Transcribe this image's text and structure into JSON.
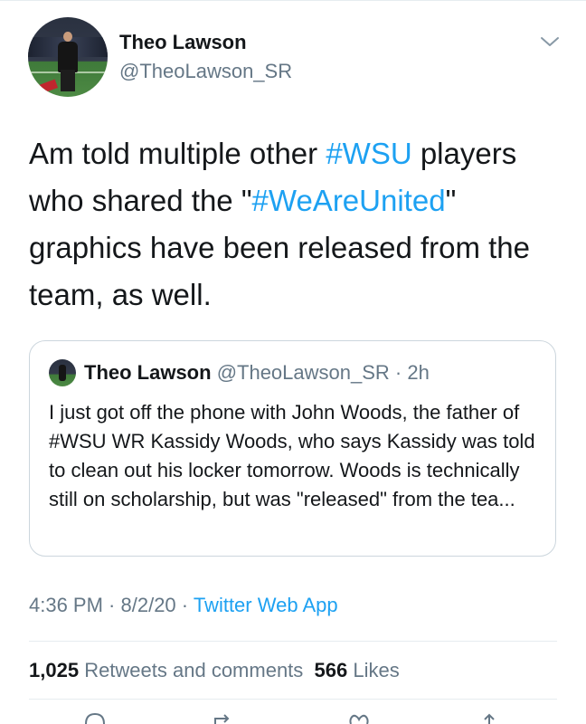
{
  "author": {
    "name": "Theo Lawson",
    "handle": "@TheoLawson_SR"
  },
  "tweet": {
    "text_parts": {
      "t1": "Am told multiple other ",
      "h1": "#WSU",
      "t2": " players who shared the \"",
      "h2": "#WeAreUnited",
      "t3": "\" graphics have been released from the team, as well."
    }
  },
  "quoted_tweet": {
    "name": "Theo Lawson",
    "handle": "@TheoLawson_SR",
    "time": " · 2h",
    "text": "I just got off the phone with John Woods, the father of #WSU WR Kassidy Woods, who says Kassidy was told to clean out his locker tomorrow. Woods is technically still on scholarship, but was \"released\" from the tea..."
  },
  "meta": {
    "time": "4:36 PM",
    "date": "8/2/20",
    "sep": " · ",
    "app": "Twitter Web App"
  },
  "stats": {
    "retweets_count": "1,025",
    "retweets_label": "Retweets and comments",
    "likes_count": "566",
    "likes_label": "Likes"
  },
  "icons": {
    "menu": "chevron-down-icon",
    "actions": [
      "reply-icon",
      "retweet-icon",
      "like-icon",
      "share-icon"
    ]
  },
  "colors": {
    "accent": "#1da1f2",
    "text": "#14171a",
    "secondary": "#657786",
    "border": "#ccd6dd"
  }
}
